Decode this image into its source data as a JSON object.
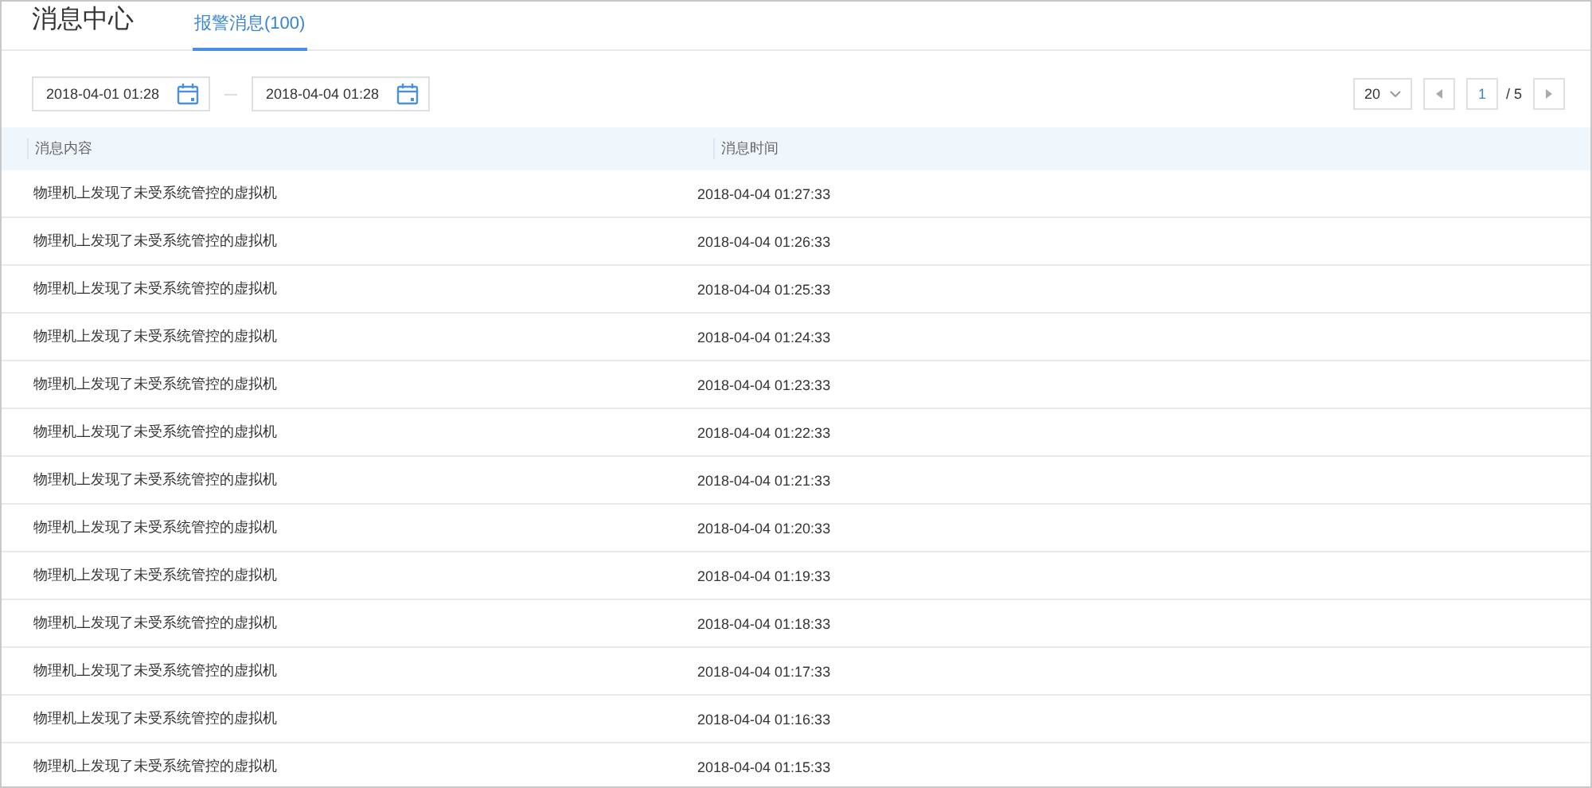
{
  "header": {
    "title": "消息中心",
    "tabs": [
      {
        "label": "报警消息(100)",
        "selected": true
      }
    ]
  },
  "filter": {
    "start_date": "2018-04-01 01:28",
    "end_date": "2018-04-04 01:28"
  },
  "pagination": {
    "page_size": "20",
    "current_page": "1",
    "total_pages": "/ 5"
  },
  "table": {
    "columns": [
      "消息内容",
      "消息时间"
    ],
    "rows": [
      [
        "物理机上发现了未受系统管控的虚拟机",
        "2018-04-04 01:27:33"
      ],
      [
        "物理机上发现了未受系统管控的虚拟机",
        "2018-04-04 01:26:33"
      ],
      [
        "物理机上发现了未受系统管控的虚拟机",
        "2018-04-04 01:25:33"
      ],
      [
        "物理机上发现了未受系统管控的虚拟机",
        "2018-04-04 01:24:33"
      ],
      [
        "物理机上发现了未受系统管控的虚拟机",
        "2018-04-04 01:23:33"
      ],
      [
        "物理机上发现了未受系统管控的虚拟机",
        "2018-04-04 01:22:33"
      ],
      [
        "物理机上发现了未受系统管控的虚拟机",
        "2018-04-04 01:21:33"
      ],
      [
        "物理机上发现了未受系统管控的虚拟机",
        "2018-04-04 01:20:33"
      ],
      [
        "物理机上发现了未受系统管控的虚拟机",
        "2018-04-04 01:19:33"
      ],
      [
        "物理机上发现了未受系统管控的虚拟机",
        "2018-04-04 01:18:33"
      ],
      [
        "物理机上发现了未受系统管控的虚拟机",
        "2018-04-04 01:17:33"
      ],
      [
        "物理机上发现了未受系统管控的虚拟机",
        "2018-04-04 01:16:33"
      ],
      [
        "物理机上发现了未受系统管控的虚拟机",
        "2018-04-04 01:15:33"
      ]
    ]
  }
}
